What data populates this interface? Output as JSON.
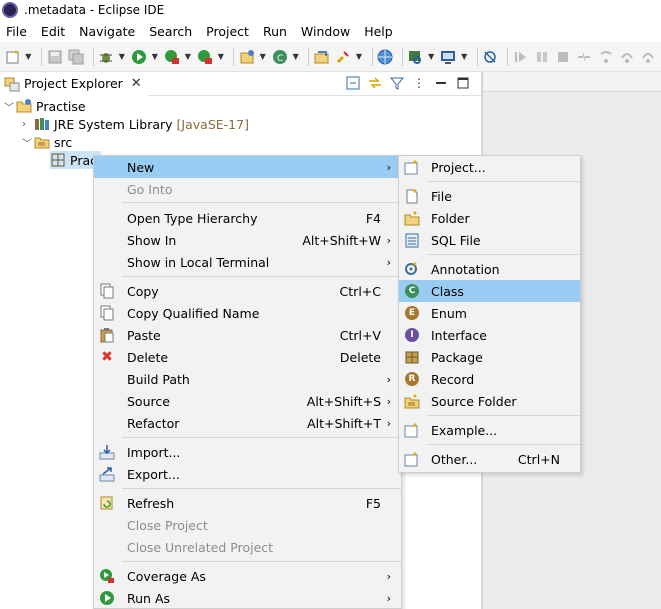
{
  "window": {
    "title": ".metadata - Eclipse IDE"
  },
  "menubar": [
    "File",
    "Edit",
    "Navigate",
    "Search",
    "Project",
    "Run",
    "Window",
    "Help"
  ],
  "explorer": {
    "tab_label": "Project Explorer",
    "tree": {
      "project": "Practise",
      "jre": "JRE System Library",
      "jre_version": "[JavaSE-17]",
      "src": "src",
      "package": "Prac"
    }
  },
  "context_menu": {
    "new": "New",
    "go_into": "Go Into",
    "open_type_hierarchy": "Open Type Hierarchy",
    "open_type_hierarchy_key": "F4",
    "show_in": "Show In",
    "show_in_key": "Alt+Shift+W",
    "show_in_local_terminal": "Show in Local Terminal",
    "copy": "Copy",
    "copy_key": "Ctrl+C",
    "copy_qualified_name": "Copy Qualified Name",
    "paste": "Paste",
    "paste_key": "Ctrl+V",
    "delete": "Delete",
    "delete_key": "Delete",
    "build_path": "Build Path",
    "source": "Source",
    "source_key": "Alt+Shift+S",
    "refactor": "Refactor",
    "refactor_key": "Alt+Shift+T",
    "import": "Import...",
    "export": "Export...",
    "refresh": "Refresh",
    "refresh_key": "F5",
    "close_project": "Close Project",
    "close_unrelated_project": "Close Unrelated Project",
    "coverage_as": "Coverage As",
    "run_as": "Run As"
  },
  "new_submenu": {
    "project": "Project...",
    "file": "File",
    "folder": "Folder",
    "sql_file": "SQL File",
    "annotation": "Annotation",
    "class": "Class",
    "enum": "Enum",
    "interface": "Interface",
    "package": "Package",
    "record": "Record",
    "source_folder": "Source Folder",
    "example": "Example...",
    "other": "Other...",
    "other_key": "Ctrl+N"
  },
  "colors": {
    "highlight": "#99ccf2",
    "menu_bg": "#f2f2f2",
    "disabled_text": "#8d8d8d",
    "delete_red": "#d9342b"
  }
}
